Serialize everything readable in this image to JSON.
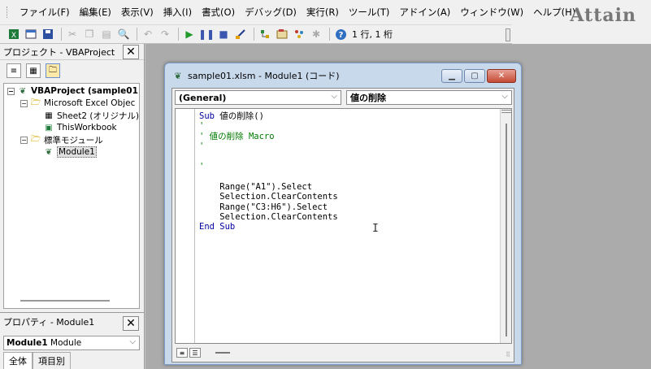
{
  "menubar": {
    "items": [
      "ファイル(F)",
      "編集(E)",
      "表示(V)",
      "挿入(I)",
      "書式(O)",
      "デバッグ(D)",
      "実行(R)",
      "ツール(T)",
      "アドイン(A)",
      "ウィンドウ(W)",
      "ヘルプ(H)"
    ],
    "logo": "Attain"
  },
  "toolbar": {
    "position_text": "1 行, 1 桁",
    "icons": [
      "excel-icon",
      "insert-userform-icon",
      "save-icon",
      "cut-icon",
      "copy-icon",
      "paste-icon",
      "find-icon",
      "undo-icon",
      "redo-icon",
      "run-icon",
      "break-icon",
      "reset-icon",
      "design-mode-icon",
      "project-explorer-icon",
      "properties-icon",
      "object-browser-icon",
      "toolbox-icon",
      "help-icon"
    ]
  },
  "project": {
    "title": "プロジェクト - VBAProject",
    "close": "✕",
    "tree": {
      "root": "VBAProject (sample01",
      "excel_objects": "Microsoft Excel Objec",
      "sheet2": "Sheet2 (オリジナル)",
      "thisworkbook": "ThisWorkbook",
      "modules": "標準モジュール",
      "module1": "Module1"
    }
  },
  "properties": {
    "title": "プロパティ - Module1",
    "close": "✕",
    "object_name": "Module1",
    "object_type": "Module",
    "tabs": [
      "全体",
      "項目別"
    ]
  },
  "code_window": {
    "title": "sample01.xlsm - Module1 (コード)",
    "object_combo": "(General)",
    "procedure_combo": "値の削除",
    "lines": [
      {
        "kw": "Sub ",
        "text": "値の削除()",
        "cls": "pl"
      },
      {
        "kw": "",
        "text": "'",
        "cls": "cm"
      },
      {
        "kw": "",
        "text": "' 値の削除 Macro",
        "cls": "cm"
      },
      {
        "kw": "",
        "text": "'",
        "cls": "cm"
      },
      {
        "kw": "",
        "text": "",
        "cls": "pl"
      },
      {
        "kw": "",
        "text": "'",
        "cls": "cm"
      },
      {
        "kw": "",
        "text": "",
        "cls": "pl"
      },
      {
        "kw": "",
        "text": "    Range(\"A1\").Select",
        "cls": "pl"
      },
      {
        "kw": "",
        "text": "    Selection.ClearContents",
        "cls": "pl"
      },
      {
        "kw": "",
        "text": "    Range(\"C3:H6\").Select",
        "cls": "pl"
      },
      {
        "kw": "",
        "text": "    Selection.ClearContents",
        "cls": "pl"
      },
      {
        "kw": "End Sub",
        "text": "",
        "cls": "pl"
      }
    ]
  },
  "colors": {
    "keyword": "#0000a0",
    "comment": "#007a00",
    "title_bar": "#c9d9ec"
  }
}
